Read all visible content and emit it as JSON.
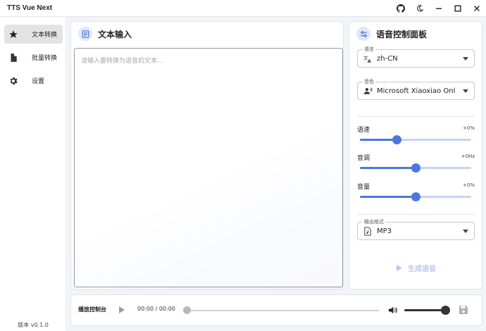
{
  "titlebar": {
    "title": "TTS Vue Next",
    "icons": [
      "github-icon",
      "theme-moon-icon",
      "minimize-icon",
      "maximize-icon",
      "close-icon"
    ]
  },
  "sidebar": {
    "items": [
      {
        "label": "文本转换",
        "icon": "star-icon",
        "active": true
      },
      {
        "label": "批量转换",
        "icon": "file-icon",
        "active": false
      },
      {
        "label": "设置",
        "icon": "gear-icon",
        "active": false
      }
    ],
    "version": "版本 v0.1.0"
  },
  "text_input": {
    "title": "文本输入",
    "placeholder": "请输入要转换为语音的文本...",
    "value": ""
  },
  "voice_panel": {
    "title": "语音控制面板",
    "language": {
      "label": "语言",
      "value": "zh-CN"
    },
    "voice": {
      "label": "音色",
      "value": "Microsoft Xiaoxiao Online"
    },
    "rate": {
      "label": "语速",
      "value_text": "+0%",
      "level": 0.33
    },
    "pitch": {
      "label": "音调",
      "value_text": "+0Hz",
      "level": 0.5
    },
    "volume": {
      "label": "音量",
      "value_text": "+0%",
      "level": 0.5
    },
    "format": {
      "label": "输出格式",
      "value": "MP3"
    },
    "generate_label": "生成语音"
  },
  "player": {
    "title": "播放控制台",
    "time": "00:00 / 00:00",
    "progress": 0,
    "volume_level": 1.0
  },
  "colors": {
    "accent": "#4a78e0",
    "accent_light": "#c5d3f5",
    "disabled": "#b9c8ef"
  }
}
